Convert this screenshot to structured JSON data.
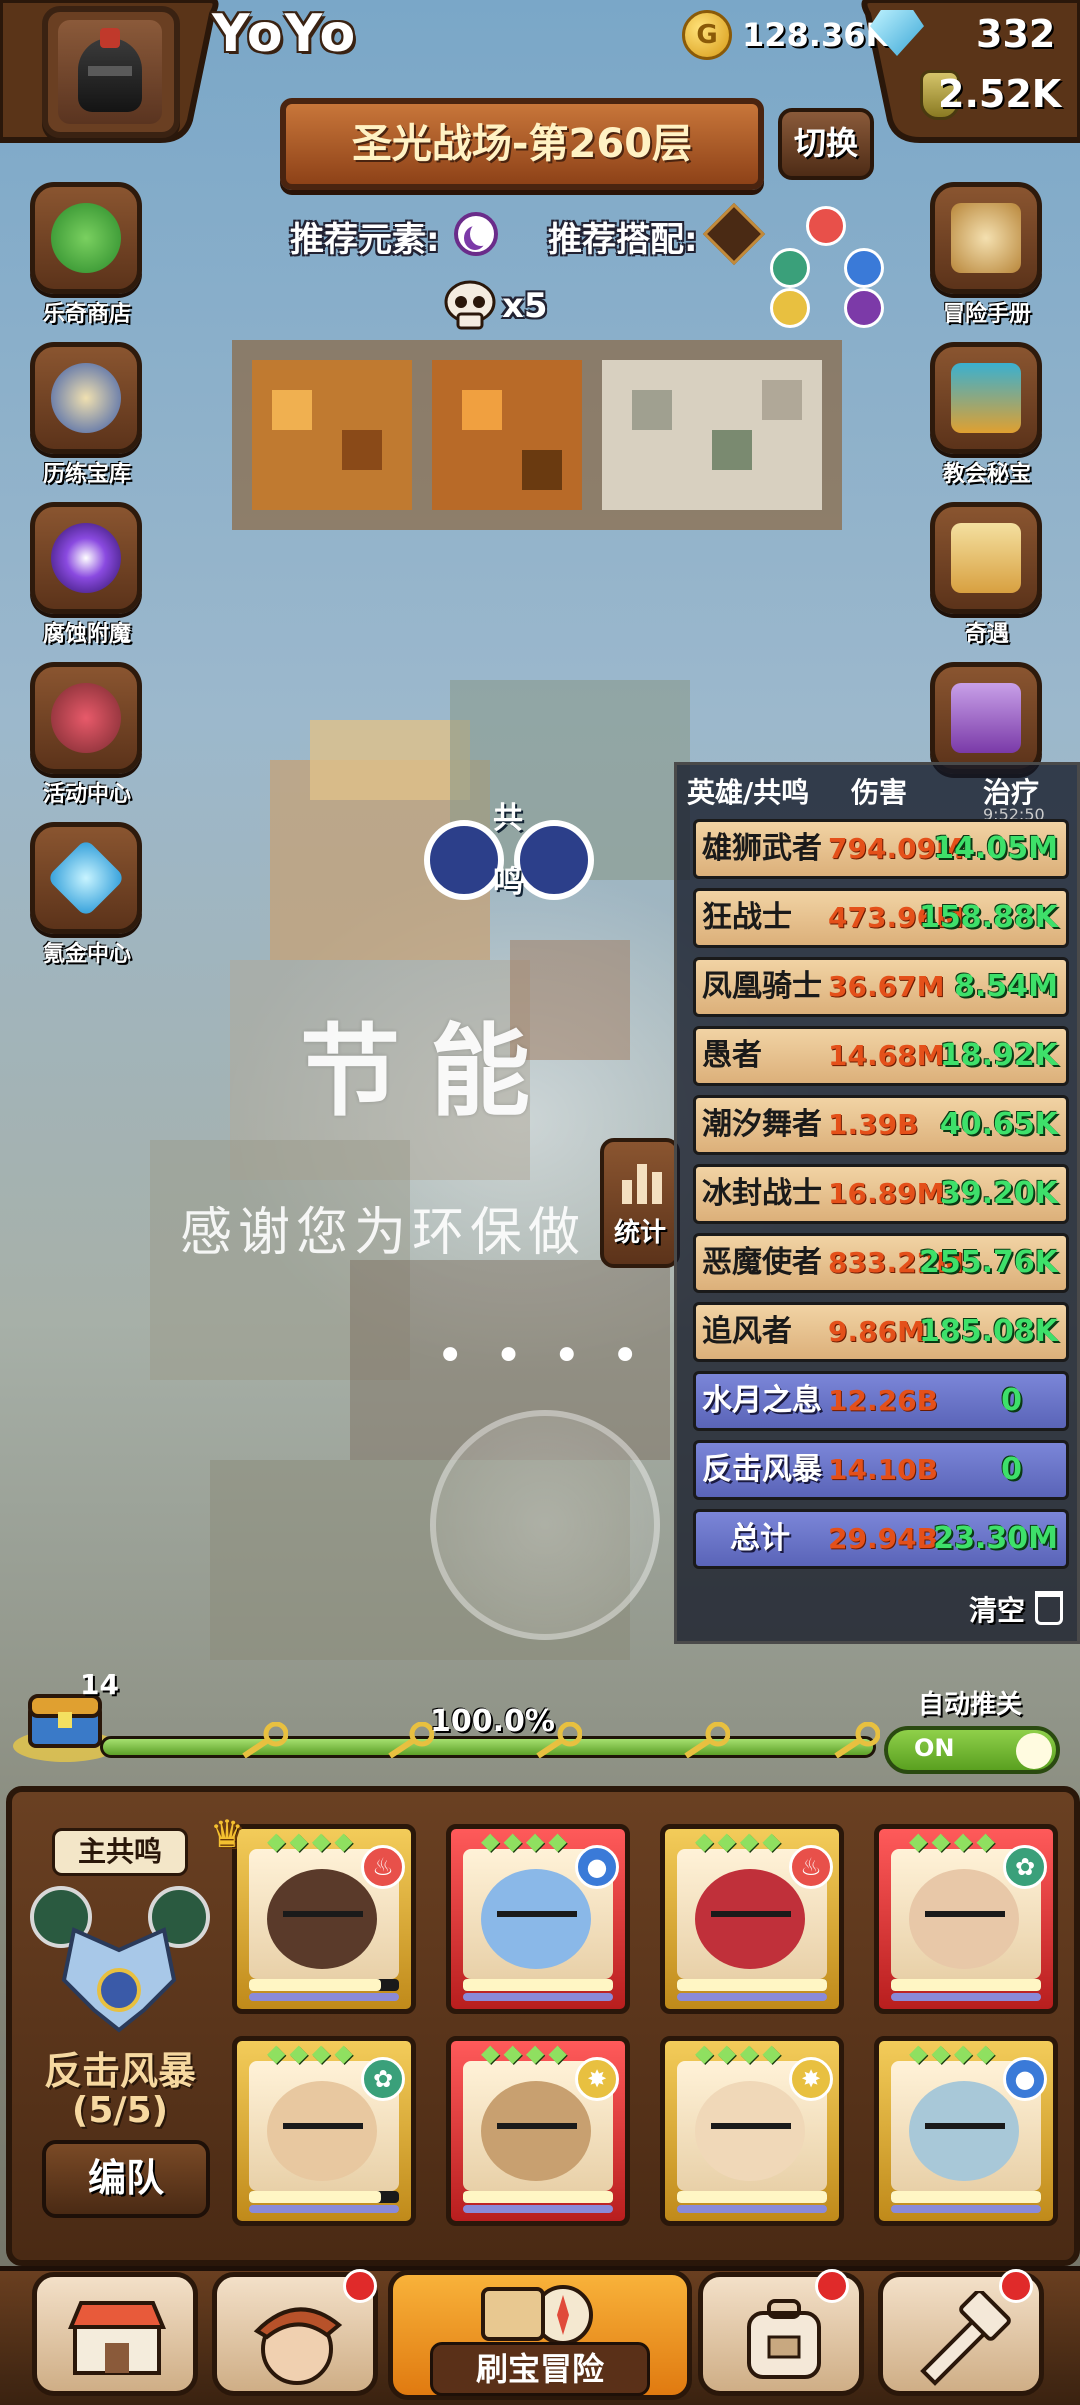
{
  "player": {
    "name": "YoYo"
  },
  "resources": {
    "coins": "128.36K",
    "gems": "332",
    "potions": "2.52K"
  },
  "stage": {
    "title": "圣光战场-第260层",
    "switch_label": "切换"
  },
  "recommend": {
    "element_label": "推荐元素:",
    "combo_label": "推荐搭配:"
  },
  "enemy": {
    "skull_multiplier": "x5"
  },
  "left_menu": [
    {
      "label": "乐奇商店",
      "icon": "clover-icon"
    },
    {
      "label": "历练宝库",
      "icon": "scroll-icon"
    },
    {
      "label": "腐蚀附魔",
      "icon": "portal-icon"
    },
    {
      "label": "活动中心",
      "icon": "bouquet-icon"
    },
    {
      "label": "氪金中心",
      "icon": "diamond-icon"
    }
  ],
  "right_menu": [
    {
      "label": "冒险手册",
      "icon": "manual-icon"
    },
    {
      "label": "教会秘宝",
      "icon": "chest-icon"
    },
    {
      "label": "奇遇",
      "icon": "quest-icon"
    },
    {
      "label": "",
      "icon": "treasure-icon"
    }
  ],
  "resonance_badge": {
    "top": "共",
    "bottom": "鸣"
  },
  "overlay": {
    "title": "节能",
    "subtitle": "感谢您为环保做",
    "dots": "••••"
  },
  "stats_button": {
    "label": "统计"
  },
  "stats_panel": {
    "headers": {
      "hero": "英雄/共鸣",
      "damage": "伤害",
      "heal": "治疗"
    },
    "timer": "9:52:50",
    "rows": [
      {
        "name": "雄狮武者",
        "damage": "794.09M",
        "heal": "14.05M",
        "kind": "hero"
      },
      {
        "name": "狂战士",
        "damage": "473.96M",
        "heal": "158.88K",
        "kind": "hero"
      },
      {
        "name": "凤凰骑士",
        "damage": "36.67M",
        "heal": "8.54M",
        "kind": "hero"
      },
      {
        "name": "愚者",
        "damage": "14.68M",
        "heal": "18.92K",
        "kind": "hero"
      },
      {
        "name": "潮汐舞者",
        "damage": "1.39B",
        "heal": "40.65K",
        "kind": "hero"
      },
      {
        "name": "冰封战士",
        "damage": "16.89M",
        "heal": "39.20K",
        "kind": "hero"
      },
      {
        "name": "恶魔使者",
        "damage": "833.22M",
        "heal": "255.76K",
        "kind": "hero"
      },
      {
        "name": "追风者",
        "damage": "9.86M",
        "heal": "185.08K",
        "kind": "hero"
      },
      {
        "name": "水月之息",
        "damage": "12.26B",
        "heal": "0",
        "kind": "resonance"
      },
      {
        "name": "反击风暴",
        "damage": "14.10B",
        "heal": "0",
        "kind": "resonance"
      },
      {
        "name": "总计",
        "damage": "29.94B",
        "heal": "23.30M",
        "kind": "total"
      }
    ],
    "clear_label": "清空"
  },
  "progress": {
    "chest_count": "14",
    "percent_label": "100.0%",
    "fill_fraction": 1.0
  },
  "auto_advance": {
    "label": "自动推关",
    "toggle_label": "ON",
    "enabled": true
  },
  "team": {
    "main_resonance_label": "主共鸣",
    "resonance_name": "反击风暴",
    "resonance_count": "(5/5)",
    "formation_button": "编队",
    "heroes": [
      {
        "frame": "gold",
        "element": "fire",
        "skin": "#5a3a2a",
        "hp": 0.88
      },
      {
        "frame": "red",
        "element": "water",
        "skin": "#8ab8e8",
        "hp": 1.0
      },
      {
        "frame": "gold",
        "element": "fire",
        "skin": "#c0303a",
        "hp": 1.0
      },
      {
        "frame": "red",
        "element": "wind",
        "skin": "#e8c8a8",
        "hp": 1.0
      },
      {
        "frame": "gold",
        "element": "wind",
        "skin": "#e8c8a0",
        "hp": 0.88
      },
      {
        "frame": "red",
        "element": "light",
        "skin": "#c8a070",
        "hp": 1.0
      },
      {
        "frame": "gold",
        "element": "light",
        "skin": "#f0d8b8",
        "hp": 1.0
      },
      {
        "frame": "gold",
        "element": "water",
        "skin": "#a8c8d8",
        "hp": 1.0
      }
    ]
  },
  "bottom_nav": {
    "center_label": "刷宝冒险",
    "items": [
      {
        "icon": "shop-icon",
        "badge": false
      },
      {
        "icon": "hero-icon",
        "badge": true
      },
      {
        "icon": "backpack-icon",
        "badge": true
      },
      {
        "icon": "forge-icon",
        "badge": true
      }
    ]
  },
  "colors": {
    "accent": "#f8b23a",
    "heal": "#3ee06a",
    "damage": "#e4501a",
    "resonance_row": "#6b76c8"
  }
}
